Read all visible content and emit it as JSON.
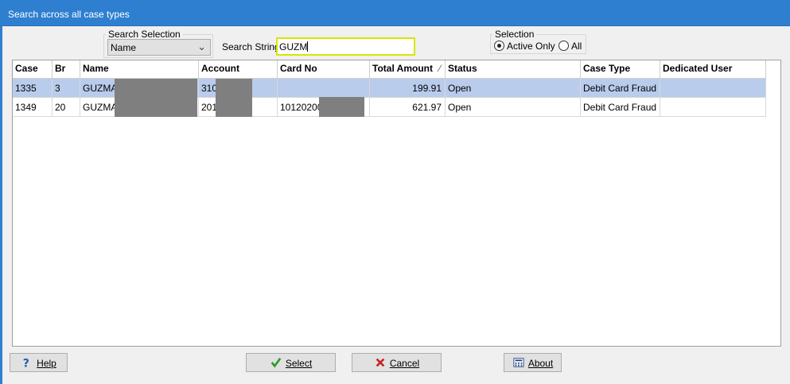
{
  "window": {
    "title": "Search across all case types"
  },
  "search_selection": {
    "legend": "Search Selection",
    "value": "Name"
  },
  "search_string": {
    "label": "Search String",
    "value": "GUZM"
  },
  "selection": {
    "legend": "Selection",
    "options": [
      {
        "label": "Active Only",
        "checked": true
      },
      {
        "label": "All",
        "checked": false
      }
    ]
  },
  "grid": {
    "columns": [
      "Case",
      "Br",
      "Name",
      "Account",
      "Card No",
      "Total Amount",
      "Status",
      "Case Type",
      "Dedicated User"
    ],
    "sorted_column": "Total Amount",
    "rows": [
      {
        "case": "1335",
        "br": "3",
        "name": "GUZMAN",
        "account": "310",
        "card_no": "",
        "total_amount": "199.91",
        "status": "Open",
        "case_type": "Debit Card Fraud",
        "dedicated_user": "",
        "selected": true
      },
      {
        "case": "1349",
        "br": "20",
        "name": "GUZMAN",
        "account": "201",
        "card_no": "10120200",
        "total_amount": "621.97",
        "status": "Open",
        "case_type": "Debit Card Fraud",
        "dedicated_user": "",
        "selected": false
      }
    ]
  },
  "buttons": {
    "help": "Help",
    "select": "Select",
    "cancel": "Cancel",
    "about": "About"
  },
  "colors": {
    "titlebar": "#2f7fd0",
    "selected_row": "#b9ccec",
    "input_focus_border": "#d8e600",
    "redaction": "#7f7f7f"
  },
  "icons": {
    "help": "question-mark-icon",
    "select": "checkmark-icon",
    "cancel": "x-icon",
    "about": "calculator-icon"
  }
}
